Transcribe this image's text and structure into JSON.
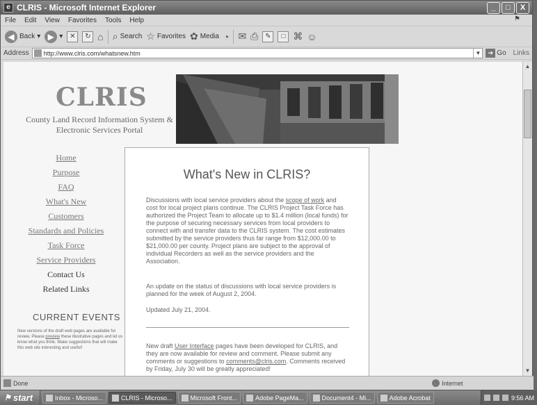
{
  "window": {
    "title": "CLRIS - Microsoft Internet Explorer",
    "controls": [
      "_",
      "□",
      "X"
    ]
  },
  "menu": [
    "File",
    "Edit",
    "View",
    "Favorites",
    "Tools",
    "Help"
  ],
  "toolbar": {
    "back": "Back",
    "search": "Search",
    "favorites": "Favorites",
    "media": "Media"
  },
  "address": {
    "label": "Address",
    "url": "http://www.clris.com/whatsnew.htm",
    "go": "Go",
    "links": "Links"
  },
  "site": {
    "title": "CLRIS",
    "subtitle": "County Land Record Information System & Electronic Services Portal"
  },
  "nav": [
    {
      "label": "Home",
      "style": "link"
    },
    {
      "label": "Purpose",
      "style": "link"
    },
    {
      "label": "FAQ",
      "style": "link"
    },
    {
      "label": "What's New",
      "style": "link"
    },
    {
      "label": "Customers",
      "style": "link"
    },
    {
      "label": "Standards and Policies",
      "style": "link"
    },
    {
      "label": "Task Force",
      "style": "link"
    },
    {
      "label": "Service Providers",
      "style": "link"
    },
    {
      "label": "Contact Us",
      "style": "plain"
    },
    {
      "label": "Related Links",
      "style": "plain"
    }
  ],
  "events": {
    "title": "CURRENT EVENTS",
    "text_before": "New versions of the draft web pages are available for review. Please ",
    "link": "preview",
    "text_after": " these illustrative pages and let us know what you think. Make suggestions that will make this web site interesting and useful!"
  },
  "content": {
    "heading": "What's New in CLRIS?",
    "p1_before": "Discussions with local service providers about the ",
    "p1_link": "scope of work",
    "p1_after": " and cost for local project plans continue. The CLRIS Project Task Force has authorized the Project Team to allocate up to $1.4 million (local funds) for the purpose of securing necessary services from local providers to connect with and transfer data to the CLRIS system. The cost estimates submitted by the service providers thus far range from $12,000.00 to $21,000.00 per county. Project plans are subject to the approval of individual Recorders as well as the service providers and the Association.",
    "p2": "An update on the status of discussions with local service providers is planned for the week of August 2, 2004.",
    "updated": "Updated July 21, 2004.",
    "p3_before": "New draft ",
    "p3_link1": "User Interface",
    "p3_mid": " pages have been developed for CLRIS, and they are now available for review and comment. Please submit any comments or suggestions to ",
    "p3_link2": "comments@clris.com",
    "p3_after": ". Comments received by Friday, July 30 will be greatly appreciated!"
  },
  "status": {
    "left": "Done",
    "zone": "Internet"
  },
  "taskbar": {
    "start": "start",
    "tasks": [
      {
        "label": "Inbox - Microso...",
        "active": false
      },
      {
        "label": "CLRIS - Microso...",
        "active": true
      },
      {
        "label": "Microsoft Front...",
        "active": false
      },
      {
        "label": "Adobe PageMa...",
        "active": false
      },
      {
        "label": "Document4 - Mi...",
        "active": false
      },
      {
        "label": "Adobe Acrobat",
        "active": false
      }
    ],
    "clock": "9:56 AM"
  }
}
